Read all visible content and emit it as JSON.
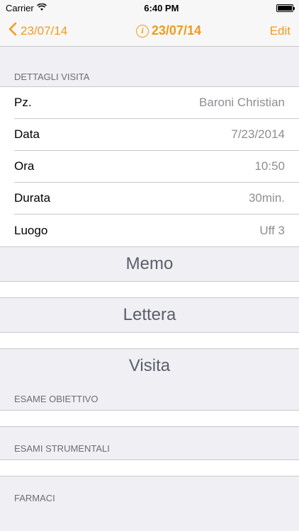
{
  "status": {
    "carrier": "Carrier",
    "time": "6:40 PM",
    "battery_level": 1.0
  },
  "nav": {
    "back_label": "23/07/14",
    "title": "23/07/14",
    "edit_label": "Edit"
  },
  "details": {
    "header": "DETTAGLI VISITA",
    "rows": [
      {
        "label": "Pz.",
        "value": "Baroni Christian"
      },
      {
        "label": "Data",
        "value": "7/23/2014"
      },
      {
        "label": "Ora",
        "value": "10:50"
      },
      {
        "label": "Durata",
        "value": "30min."
      },
      {
        "label": "Luogo",
        "value": "Uff 3"
      }
    ]
  },
  "sections": {
    "memo": "Memo",
    "lettera": "Lettera",
    "visita": "Visita",
    "esame_obiettivo": "ESAME OBIETTIVO",
    "esami_strumentali": "ESAMI STRUMENTALI",
    "farmaci": "FARMACI"
  },
  "colors": {
    "accent": "#f29a1d",
    "background": "#efeff4",
    "secondary_text": "#8e8e93"
  }
}
